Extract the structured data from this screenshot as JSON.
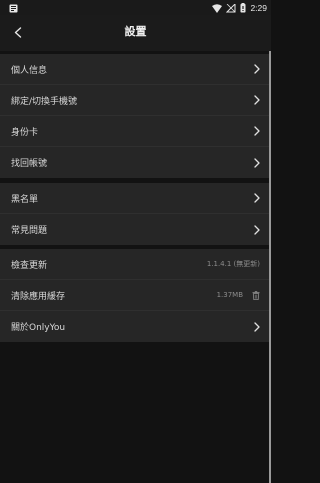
{
  "status_bar": {
    "time": "2:29",
    "icons": [
      "notification-icon",
      "wifi-icon",
      "no-sim-icon",
      "battery-icon"
    ]
  },
  "header": {
    "title": "設置"
  },
  "groups": [
    {
      "items": [
        {
          "label": "個人信息"
        },
        {
          "label": "綁定/切換手機號"
        },
        {
          "label": "身份卡"
        },
        {
          "label": "找回帳號"
        }
      ]
    },
    {
      "items": [
        {
          "label": "黑名單"
        },
        {
          "label": "常見問題"
        }
      ]
    },
    {
      "items": [
        {
          "label": "檢查更新",
          "value": "1.1.4.1 (無更新)"
        },
        {
          "label": "清除應用緩存",
          "value": "1.37MB"
        },
        {
          "label": "關於OnlyYou"
        }
      ]
    }
  ],
  "colors": {
    "background": "#121212",
    "card": "#262626",
    "text": "#d9d9d9",
    "secondary_text": "#8c8c8c"
  }
}
